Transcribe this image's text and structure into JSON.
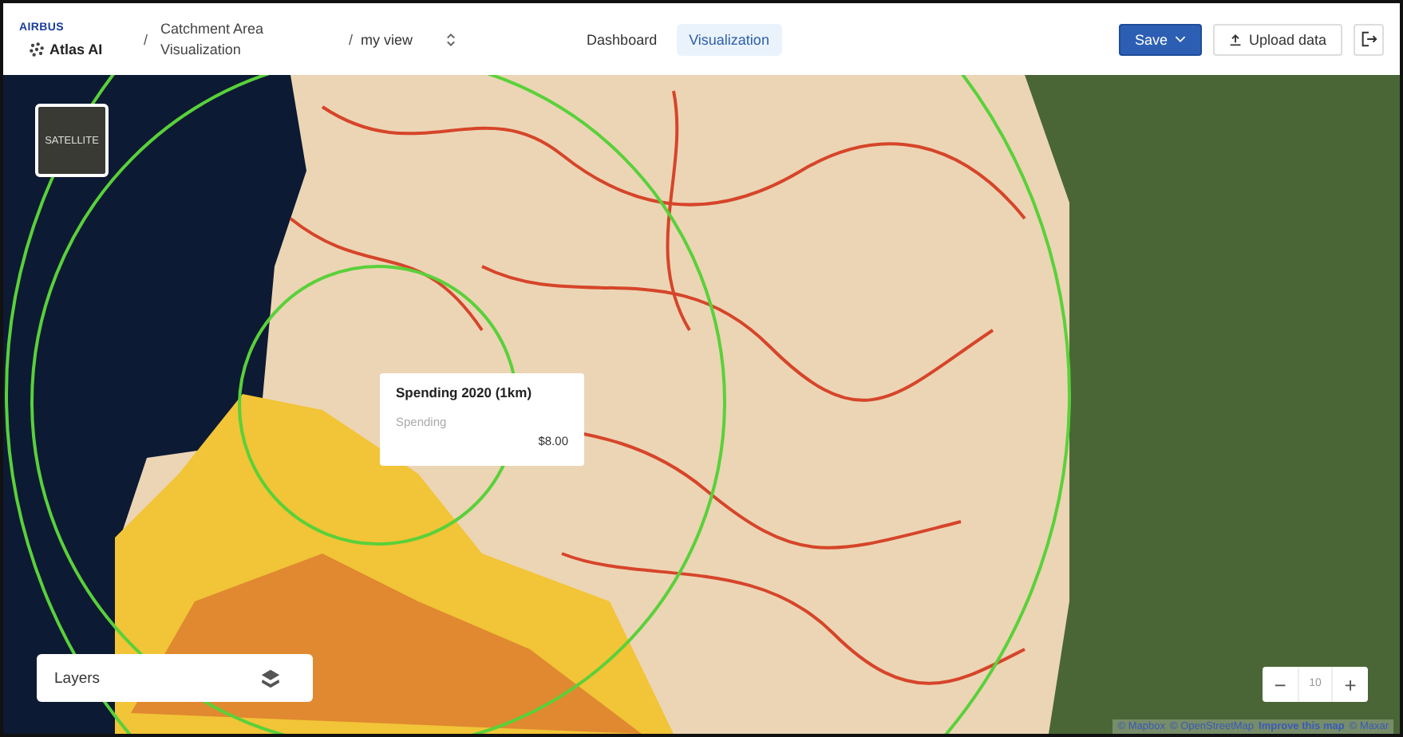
{
  "header": {
    "logo": {
      "brand": "AIRBUS",
      "product": "Atlas AI"
    },
    "breadcrumb": {
      "separator": "/",
      "project": "Catchment Area Visualization",
      "view": "my view"
    },
    "tabs": [
      {
        "label": "Dashboard",
        "selected": false
      },
      {
        "label": "Visualization",
        "selected": true
      }
    ],
    "save_button": "Save",
    "upload_button": "Upload data"
  },
  "map": {
    "basemap_button": "SATELLITE",
    "tooltip": {
      "title": "Spending 2020 (1km)",
      "label": "Spending",
      "value": "$8.00"
    },
    "layers_panel": {
      "label": "Layers"
    },
    "zoom": {
      "minus": "−",
      "level": "10",
      "plus": "+"
    },
    "attribution": [
      {
        "text": "© Mapbox",
        "kind": "plain"
      },
      {
        "text": "© OpenStreetMap",
        "kind": "plain"
      },
      {
        "text": "Improve this map",
        "kind": "link"
      },
      {
        "text": "© Maxar",
        "kind": "plain"
      }
    ]
  }
}
